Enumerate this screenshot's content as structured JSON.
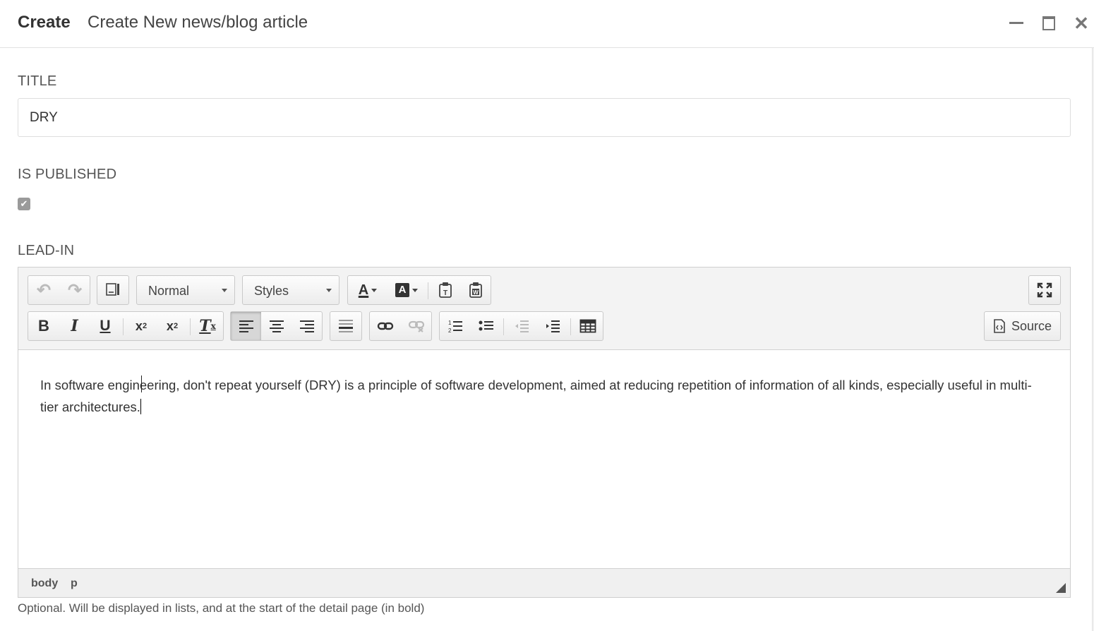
{
  "dialog": {
    "create_label": "Create",
    "title": "Create New news/blog article",
    "minimize_icon": "minimize-icon",
    "maximize_icon": "maximize-icon",
    "close_symbol": "✕"
  },
  "form": {
    "title_label": "TITLE",
    "title_value": "DRY",
    "published_label": "IS PUBLISHED",
    "published_checked": true,
    "published_check_symbol": "✔",
    "leadin_label": "LEAD-IN",
    "help_text": "Optional. Will be displayed in lists, and at the start of the detail page (in bold)"
  },
  "editor": {
    "toolbar": {
      "undo": "↶",
      "redo": "↷",
      "format_combo": "Normal",
      "styles_combo": "Styles",
      "text_color_icon": "A",
      "bg_color_icon": "A",
      "bold": "B",
      "italic": "I",
      "underline": "U",
      "subscript": "x",
      "subscript_small": "2",
      "superscript": "x",
      "superscript_small": "2",
      "remove_format": "T",
      "remove_format_small": "x",
      "source_label": "Source",
      "icons": [
        "undo-icon",
        "redo-icon",
        "templates-icon",
        "text-color-icon",
        "bg-color-icon",
        "paste-text-icon",
        "paste-word-icon",
        "maximize-editor-icon",
        "bold-icon",
        "italic-icon",
        "underline-icon",
        "subscript-icon",
        "superscript-icon",
        "remove-format-icon",
        "align-left-icon",
        "align-center-icon",
        "align-right-icon",
        "horizontal-line-icon",
        "link-icon",
        "unlink-icon",
        "numbered-list-icon",
        "bulleted-list-icon",
        "outdent-icon",
        "indent-icon",
        "table-icon",
        "source-icon"
      ]
    },
    "content": "In software engineering, don't repeat yourself (DRY) is a principle of software development, aimed at reducing repetition of information of all kinds, especially useful in multi-tier architectures.",
    "status_path": [
      "body",
      "p"
    ]
  }
}
